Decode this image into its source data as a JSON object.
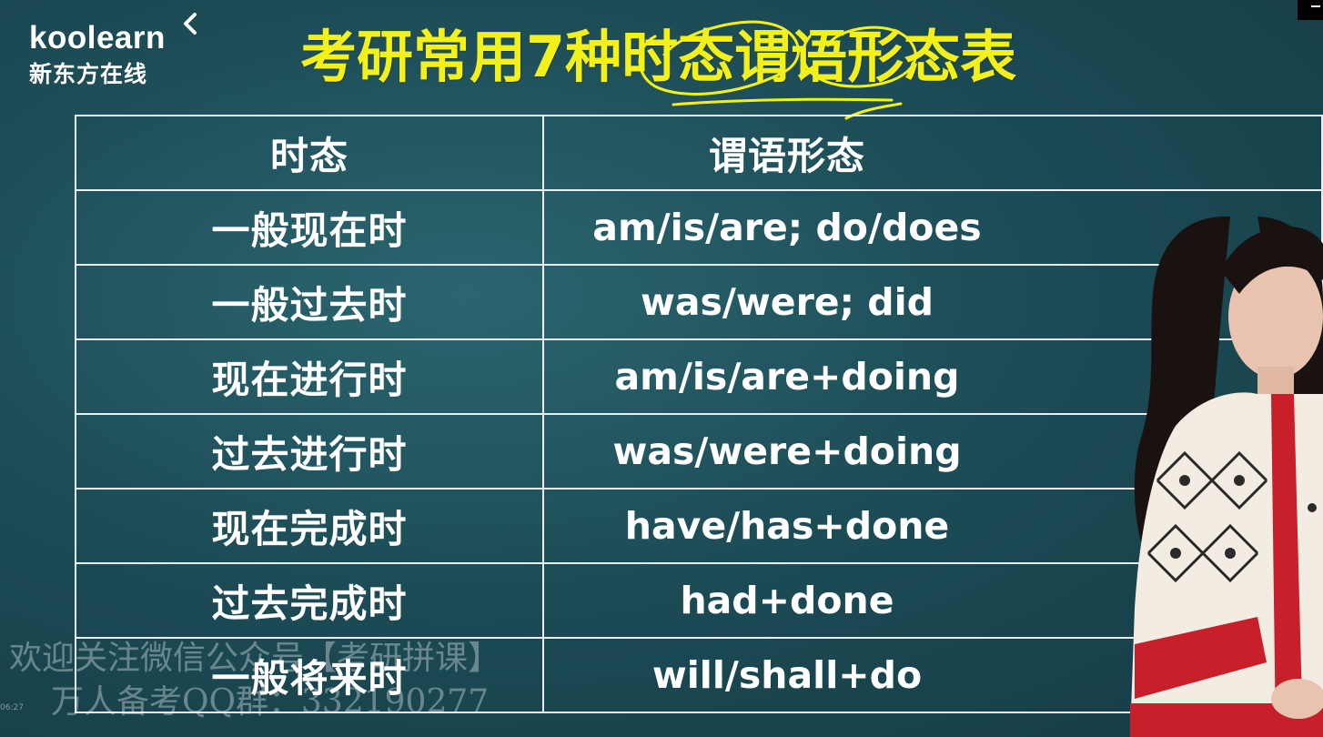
{
  "logo": {
    "brand": "koolearn",
    "brand_cn": "新东方在线"
  },
  "title": "考研常用7种时态谓语形态表",
  "table": {
    "headers": [
      "时态",
      "谓语形态"
    ],
    "rows": [
      {
        "tense": "一般现在时",
        "form": "am/is/are; do/does"
      },
      {
        "tense": "一般过去时",
        "form": "was/were; did"
      },
      {
        "tense": "现在进行时",
        "form": "am/is/are+doing"
      },
      {
        "tense": "过去进行时",
        "form": "was/were+doing"
      },
      {
        "tense": "现在完成时",
        "form": "have/has+done"
      },
      {
        "tense": "过去完成时",
        "form": "had+done"
      },
      {
        "tense": "一般将来时",
        "form": "will/shall+do"
      }
    ]
  },
  "watermark": {
    "line1": "欢迎关注微信公众号【考研拼课】",
    "line2": "万人备考QQ群：332190277"
  },
  "timestamp": "06:27",
  "colors": {
    "background": "#1d4d57",
    "title": "#f3f01a",
    "table_text": "#ffffff",
    "table_border": "#e9eef0"
  }
}
